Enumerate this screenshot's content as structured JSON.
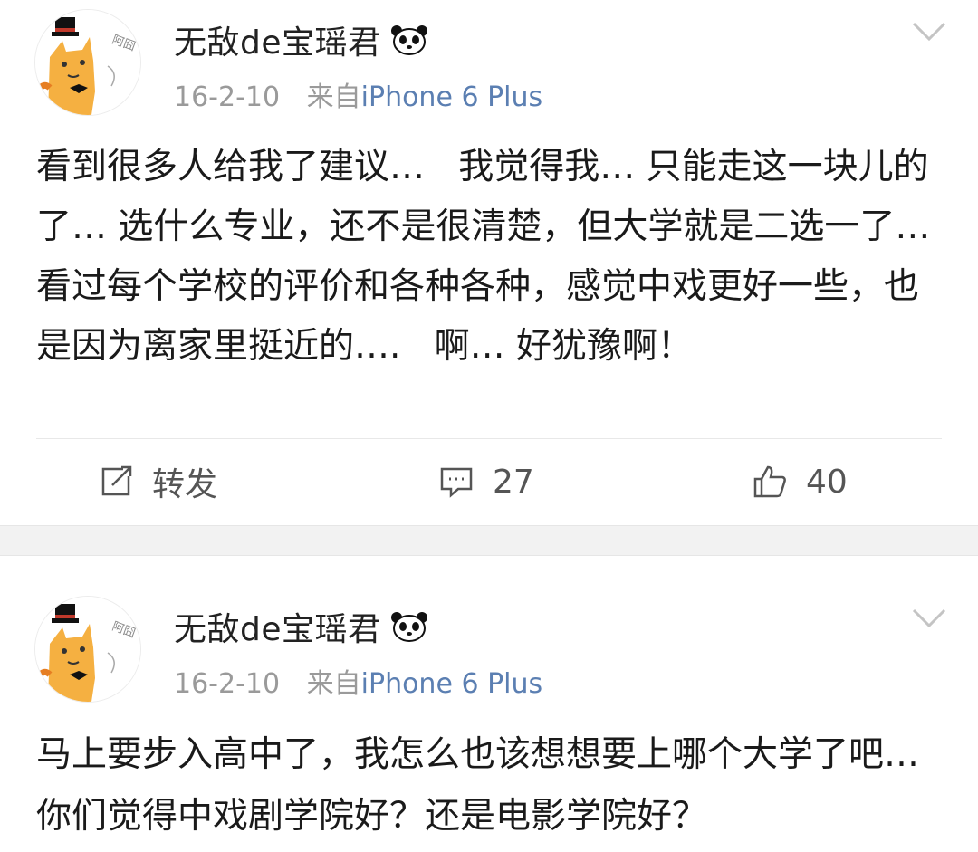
{
  "posts": [
    {
      "username": "无敌de宝瑶君",
      "date": "16-2-10",
      "source_prefix": "来自",
      "source": "iPhone 6 Plus",
      "content": "看到很多人给我了建议…   我觉得我… 只能走这一块儿的了… 选什么专业，还不是很清楚，但大学就是二选一了…  看过每个学校的评价和各种各种，感觉中戏更好一些，也是因为离家里挺近的….   啊… 好犹豫啊！",
      "actions": {
        "repost_label": "转发",
        "comment_count": "27",
        "like_count": "40"
      }
    },
    {
      "username": "无敌de宝瑶君",
      "date": "16-2-10",
      "source_prefix": "来自",
      "source": "iPhone 6 Plus",
      "content": "马上要步入高中了，我怎么也该想想要上哪个大学了吧… 你们觉得中戏剧学院好？还是电影学院好？"
    }
  ],
  "avatar": {
    "text": "阿囧"
  },
  "colors": {
    "source_link": "#5b7fb2",
    "meta": "#9a9a9a",
    "separator": "#f2f2f2"
  },
  "icons": [
    "avatar-cat-icon",
    "panda-icon",
    "chevron-down-icon",
    "repost-icon",
    "comment-icon",
    "like-icon"
  ]
}
